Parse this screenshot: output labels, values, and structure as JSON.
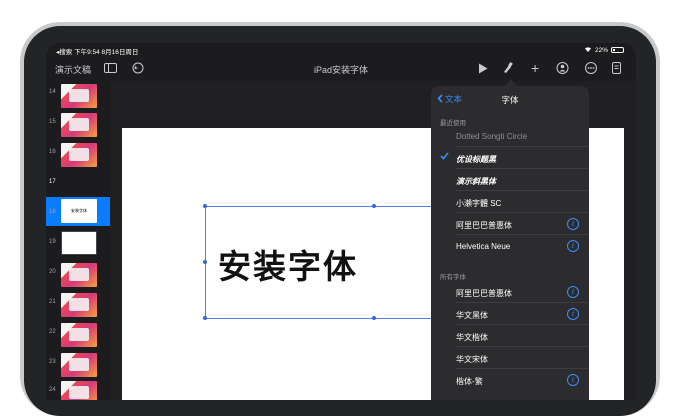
{
  "status_bar": {
    "left": "◂搜索 下午9:54 8月16日周日",
    "battery": "22%"
  },
  "toolbar": {
    "doc_name": "演示文稿",
    "title": "iPad安装字体"
  },
  "navigator": {
    "slides": [
      {
        "num": "14",
        "kind": "pic"
      },
      {
        "num": "15",
        "kind": "pic"
      },
      {
        "num": "16",
        "kind": "pic"
      },
      {
        "num": "17",
        "kind": "selected",
        "caption": "安装字体"
      },
      {
        "num": "18",
        "kind": "blank"
      },
      {
        "num": "19",
        "kind": "pic"
      },
      {
        "num": "20",
        "kind": "pic"
      },
      {
        "num": "21",
        "kind": "pic"
      },
      {
        "num": "22",
        "kind": "pic"
      },
      {
        "num": "23",
        "kind": "pic"
      },
      {
        "num": "24",
        "kind": "pic"
      }
    ]
  },
  "slide": {
    "text": "安装字体"
  },
  "font_popover": {
    "back_label": "文本",
    "title": "字体",
    "recent_label": "最近使用",
    "recent": [
      {
        "name": "Dotted Songti Circle",
        "checked": false,
        "info": false,
        "dim": true
      },
      {
        "name": "优设标题黑",
        "checked": true,
        "info": false,
        "dim": false
      },
      {
        "name": "演示斜黑体",
        "checked": false,
        "info": false,
        "dim": false
      },
      {
        "name": "小瀨字體 SC",
        "checked": false,
        "info": false,
        "dim": false
      },
      {
        "name": "阿里巴巴普惠体",
        "checked": false,
        "info": true,
        "dim": false
      },
      {
        "name": "Helvetica Neue",
        "checked": false,
        "info": true,
        "dim": false
      }
    ],
    "all_label": "所有字体",
    "all": [
      {
        "name": "阿里巴巴普惠体",
        "info": true
      },
      {
        "name": "华文黑体",
        "info": true
      },
      {
        "name": "华文楷体",
        "info": false
      },
      {
        "name": "华文宋体",
        "info": false
      },
      {
        "name": "楷体-繁",
        "info": true
      }
    ]
  }
}
